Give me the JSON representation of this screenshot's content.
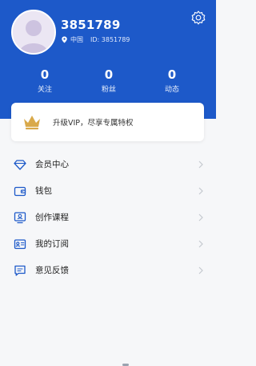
{
  "profile": {
    "username": "3851789",
    "location": "中国",
    "id_label": "ID: 3851789"
  },
  "stats": [
    {
      "value": "0",
      "label": "关注"
    },
    {
      "value": "0",
      "label": "粉丝"
    },
    {
      "value": "0",
      "label": "动态"
    }
  ],
  "vip": {
    "text": "升级VIP，尽享专属特权"
  },
  "menu": [
    {
      "label": "会员中心",
      "icon": "diamond-icon"
    },
    {
      "label": "钱包",
      "icon": "wallet-icon"
    },
    {
      "label": "创作课程",
      "icon": "course-icon"
    },
    {
      "label": "我的订阅",
      "icon": "subscription-icon"
    },
    {
      "label": "意见反馈",
      "icon": "feedback-icon"
    }
  ],
  "colors": {
    "header_bg": "#1d59c9",
    "page_bg": "#f6f7f9",
    "crown": "#d9a94a",
    "icon_blue": "#1d59c9"
  }
}
